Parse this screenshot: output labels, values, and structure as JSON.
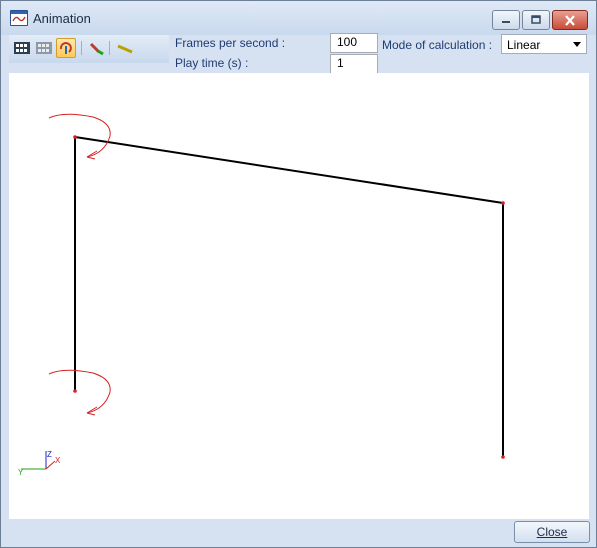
{
  "window": {
    "title": "Animation"
  },
  "toolbar": {
    "items": [
      {
        "icon": "film-play-icon",
        "active": false
      },
      {
        "icon": "film-stop-icon",
        "active": false
      },
      {
        "icon": "rotation-mode-icon",
        "active": true
      },
      {
        "icon": "color-pen-icon",
        "active": false
      },
      {
        "icon": "line-style-icon",
        "active": false
      }
    ]
  },
  "settings": {
    "fps_label": "Frames per second :",
    "fps_value": "100",
    "playtime_label": "Play time (s) :",
    "playtime_value": "1",
    "mode_label": "Mode of calculation :",
    "mode_value": "Linear"
  },
  "axes": {
    "x": "X",
    "y": "Y",
    "z": "Z"
  },
  "footer": {
    "close_label": "Close"
  },
  "colors": {
    "frame": "#000000",
    "rotation_arrow": "#d42020",
    "axis_x": "#d42020",
    "axis_y": "#1aa51a",
    "axis_z": "#2020c8"
  }
}
